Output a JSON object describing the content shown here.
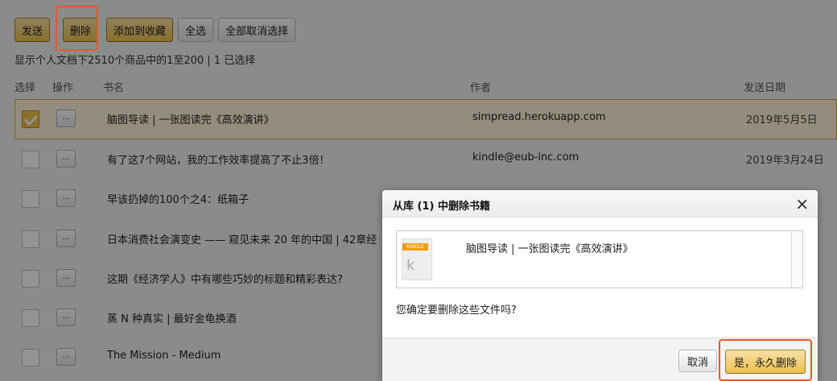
{
  "toolbar": {
    "send": "发送",
    "delete": "删除",
    "add_to_collection": "添加到收藏",
    "select_all": "全选",
    "deselect_all": "全部取消选择"
  },
  "status": "显示个人文档下2510个商品中的1至200 | 1 已选择",
  "columns": {
    "select": "选择",
    "action": "操作",
    "title": "书名",
    "author": "作者",
    "date": "发送日期"
  },
  "action_button": "...",
  "rows": [
    {
      "title": "脑图导读 | 一张图读完《高效演讲》",
      "author": "simpread.herokuapp.com",
      "date": "2019年5月5日",
      "checked": true
    },
    {
      "title": "有了这7个网站，我的工作效率提高了不止3倍！",
      "author": "kindle@eub-inc.com",
      "date": "2019年3月24日",
      "checked": false
    },
    {
      "title": "早该扔掉的100个之4：纸箱子",
      "author": "",
      "date": "",
      "checked": false
    },
    {
      "title": "日本消费社会演变史 —— 窥见未来 20 年的中国 | 42章经",
      "author": "",
      "date": "",
      "checked": false
    },
    {
      "title": "这期《经济学人》中有哪些巧妙的标题和精彩表达?",
      "author": "",
      "date": "",
      "checked": false
    },
    {
      "title": "蒸 N 种真实 | 最好金龟换酒",
      "author": "",
      "date": "",
      "checked": false
    },
    {
      "title": "The Mission - Medium",
      "author": "",
      "date": "",
      "checked": false
    }
  ],
  "dialog": {
    "title": "从库 (1) 中删除书籍",
    "close": "×",
    "item_title": "脑图导读 | 一张图读完《高效演讲》",
    "thumb_badge": "KINDLE",
    "thumb_letter": "k",
    "question": "您确定要删除这些文件吗?",
    "cancel": "取消",
    "confirm": "是，永久删除"
  },
  "colors": {
    "accent": "#f0c14b",
    "highlight": "#e8582e",
    "selected_row": "#fff3d9"
  }
}
